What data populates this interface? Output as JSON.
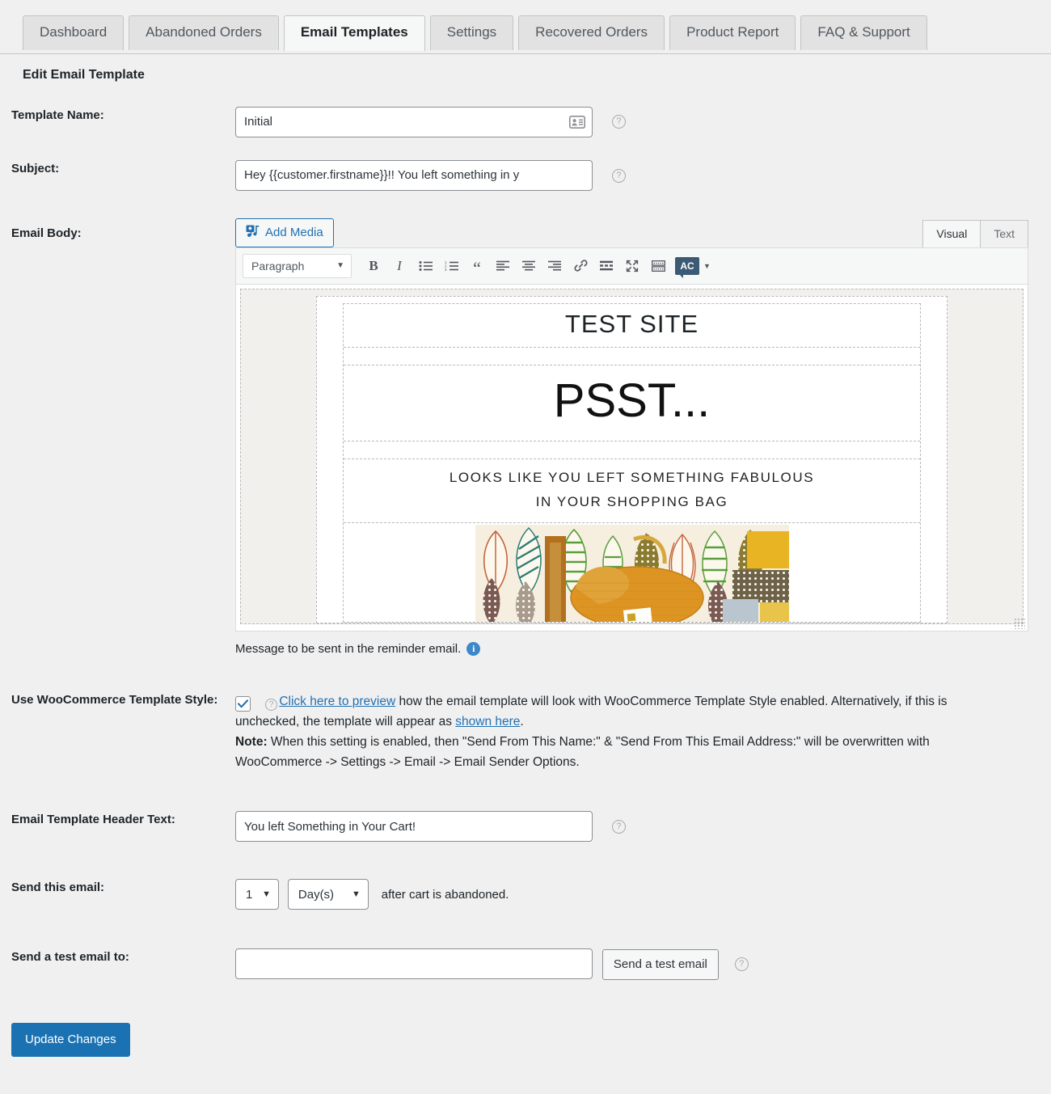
{
  "tabs": [
    {
      "label": "Dashboard",
      "active": false
    },
    {
      "label": "Abandoned Orders",
      "active": false
    },
    {
      "label": "Email Templates",
      "active": true
    },
    {
      "label": "Settings",
      "active": false
    },
    {
      "label": "Recovered Orders",
      "active": false
    },
    {
      "label": "Product Report",
      "active": false
    },
    {
      "label": "FAQ & Support",
      "active": false
    }
  ],
  "page": {
    "heading": "Edit Email Template"
  },
  "fields": {
    "template_name": {
      "label": "Template Name:",
      "value": "Initial",
      "placeholder": "",
      "autofill_icon": "contact-card-icon",
      "help_icon": "question-mark-icon"
    },
    "subject": {
      "label": "Subject:",
      "value": "Hey {{customer.firstname}}!! You left something in y",
      "placeholder": "",
      "help_icon": "question-mark-icon"
    },
    "email_body": {
      "label": "Email Body:"
    },
    "header_text": {
      "label": "Email Template Header Text:",
      "value": "You left Something in Your Cart!",
      "placeholder": "",
      "help_icon": "question-mark-icon"
    },
    "send_this_email": {
      "label": "Send this email:",
      "number_value": "1",
      "unit_value": "Day(s)",
      "suffix": "after cart is abandoned."
    },
    "test_email": {
      "label": "Send a test email to:",
      "value": "",
      "placeholder": "",
      "button_label": "Send a test email",
      "help_icon": "question-mark-icon"
    },
    "woo_style": {
      "label": "Use WooCommerce Template Style:"
    }
  },
  "editor": {
    "add_media_label": "Add Media",
    "add_media_icon": "media-icon",
    "tabs": [
      {
        "label": "Visual",
        "active": true
      },
      {
        "label": "Text",
        "active": false
      }
    ],
    "format_select": "Paragraph",
    "toolbar_buttons": [
      {
        "name": "bold-icon",
        "glyph": "B"
      },
      {
        "name": "italic-icon",
        "glyph": "I"
      },
      {
        "name": "bulleted-list-icon",
        "glyph": ""
      },
      {
        "name": "numbered-list-icon",
        "glyph": ""
      },
      {
        "name": "blockquote-icon",
        "glyph": "“"
      },
      {
        "name": "align-left-icon",
        "glyph": ""
      },
      {
        "name": "align-center-icon",
        "glyph": ""
      },
      {
        "name": "align-right-icon",
        "glyph": ""
      },
      {
        "name": "link-icon",
        "glyph": ""
      },
      {
        "name": "read-more-icon",
        "glyph": ""
      },
      {
        "name": "fullscreen-icon",
        "glyph": ""
      },
      {
        "name": "toolbar-toggle-icon",
        "glyph": ""
      },
      {
        "name": "spellcheck-icon",
        "glyph": "AC"
      }
    ],
    "note": "Message to be sent in the reminder email.",
    "note_icon": "info-icon"
  },
  "email_preview": {
    "site_title": "TEST SITE",
    "headline": "PSST...",
    "subline_1": "LOOKS LIKE YOU LEFT SOMETHING FABULOUS",
    "subline_2": "IN YOUR SHOPPING BAG",
    "image_alt": "woven-straw-bag-photo"
  },
  "woo_style": {
    "checked": true,
    "help_icon": "question-mark-icon",
    "link_preview": "Click here to preview",
    "text_1": " how the email template will look with WooCommerce Template Style enabled. Alternatively, if this is unchecked, the template will appear as ",
    "link_shown_here": "shown here",
    "text_2": ".",
    "note_label": "Note:",
    "note_text": " When this setting is enabled, then \"Send From This Name:\" & \"Send From This Email Address:\" will be overwritten with WooCommerce -> Settings -> Email -> Email Sender Options."
  },
  "footer": {
    "update_button": "Update Changes"
  },
  "colors": {
    "accent": "#2271b1",
    "primary_button": "#1b72b3",
    "page_bg": "#f0f0f1",
    "checkbox_check": "#2271b1",
    "info_icon": "#3c88c9"
  }
}
